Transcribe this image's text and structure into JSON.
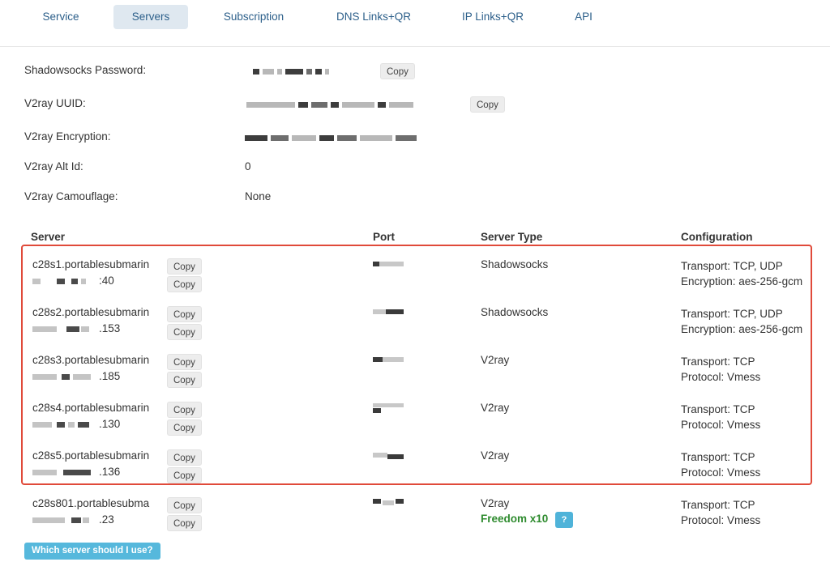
{
  "tabs": [
    {
      "label": "Service",
      "active": false
    },
    {
      "label": "Servers",
      "active": true
    },
    {
      "label": "Subscription",
      "active": false
    },
    {
      "label": "DNS Links+QR",
      "active": false
    },
    {
      "label": "IP Links+QR",
      "active": false
    },
    {
      "label": "API",
      "active": false
    }
  ],
  "credentials": {
    "ss_password_label": "Shadowsocks Password:",
    "uuid_label": "V2ray UUID:",
    "encryption_label": "V2ray Encryption:",
    "alt_id_label": "V2ray Alt Id:",
    "alt_id_value": "0",
    "camouflage_label": "V2ray Camouflage:",
    "camouflage_value": "None",
    "copy_label": "Copy"
  },
  "table": {
    "headers": {
      "server": "Server",
      "port": "Port",
      "type": "Server Type",
      "config": "Configuration"
    },
    "copy_label": "Copy",
    "rows": [
      {
        "host": "c28s1.portablesubmarin",
        "ip_tail": ":40",
        "type": "Shadowsocks",
        "config1": "Transport: TCP, UDP",
        "config2": "Encryption: aes-256-gcm"
      },
      {
        "host": "c28s2.portablesubmarin",
        "ip_tail": ".153",
        "type": "Shadowsocks",
        "config1": "Transport: TCP, UDP",
        "config2": "Encryption: aes-256-gcm"
      },
      {
        "host": "c28s3.portablesubmarin",
        "ip_tail": ".185",
        "type": "V2ray",
        "config1": "Transport: TCP",
        "config2": "Protocol: Vmess"
      },
      {
        "host": "c28s4.portablesubmarin",
        "ip_tail": ".130",
        "type": "V2ray",
        "config1": "Transport: TCP",
        "config2": "Protocol: Vmess"
      },
      {
        "host": "c28s5.portablesubmarin",
        "ip_tail": ".136",
        "type": "V2ray",
        "config1": "Transport: TCP",
        "config2": "Protocol: Vmess"
      },
      {
        "host": "c28s801.portablesubma",
        "ip_tail": ".23",
        "type": "V2ray",
        "config1": "Transport: TCP",
        "config2": "Protocol: Vmess",
        "freedom": "Freedom x10",
        "help": "?"
      }
    ]
  },
  "which_server_label": "Which server should I use?",
  "colors": {
    "accent": "#2c5f8a",
    "highlight": "#e04a3a",
    "freedom": "#2e8b2e",
    "info": "#56b8dc"
  }
}
